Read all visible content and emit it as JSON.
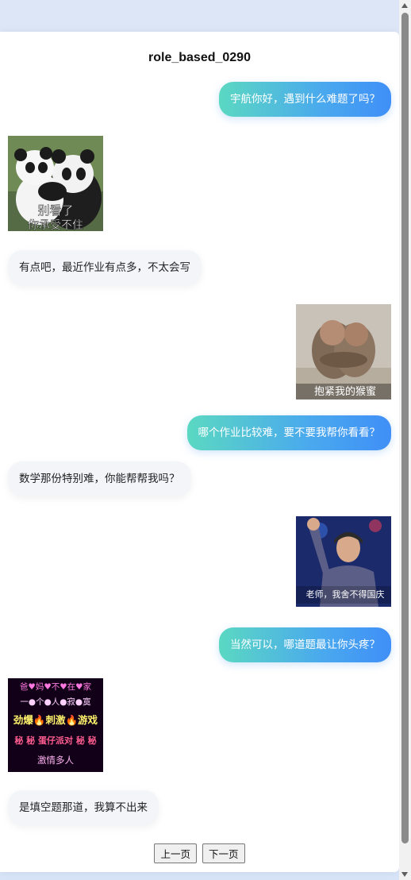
{
  "title": "role_based_0290",
  "messages": [
    {
      "side": "right",
      "type": "text",
      "text": "宇航你好，遇到什么难题了吗？"
    },
    {
      "side": "left",
      "type": "image",
      "image_name": "panda-hug-meme",
      "caption": "别看了\n你承受不住"
    },
    {
      "side": "left",
      "type": "text",
      "text": "有点吧，最近作业有点多，不太会写"
    },
    {
      "side": "right",
      "type": "image",
      "image_name": "monkeys-hug-meme",
      "caption": "抱紧我的猴蜜"
    },
    {
      "side": "right",
      "type": "text",
      "text": "哪个作业比较难，要不要我帮你看看？"
    },
    {
      "side": "left",
      "type": "text",
      "text": "数学那份特别难，你能帮帮我吗？"
    },
    {
      "side": "right",
      "type": "image",
      "image_name": "waving-host-meme",
      "caption": "老师，我舍不得国庆"
    },
    {
      "side": "right",
      "type": "text",
      "text": "当然可以，哪道题最让你头疼？"
    },
    {
      "side": "left",
      "type": "image",
      "image_name": "party-neon-meme",
      "lines": [
        "爸♥妈♥不♥在♥家",
        "一●个●人●寂●寞",
        "劲爆🔥刺激🔥游戏",
        "秘 秘 蛋仔派对 秘 秘",
        "激情多人"
      ]
    },
    {
      "side": "left",
      "type": "text",
      "text": "是填空题那道，我算不出来"
    }
  ],
  "pager": {
    "prev_label": "上一页",
    "next_label": "下一页"
  }
}
